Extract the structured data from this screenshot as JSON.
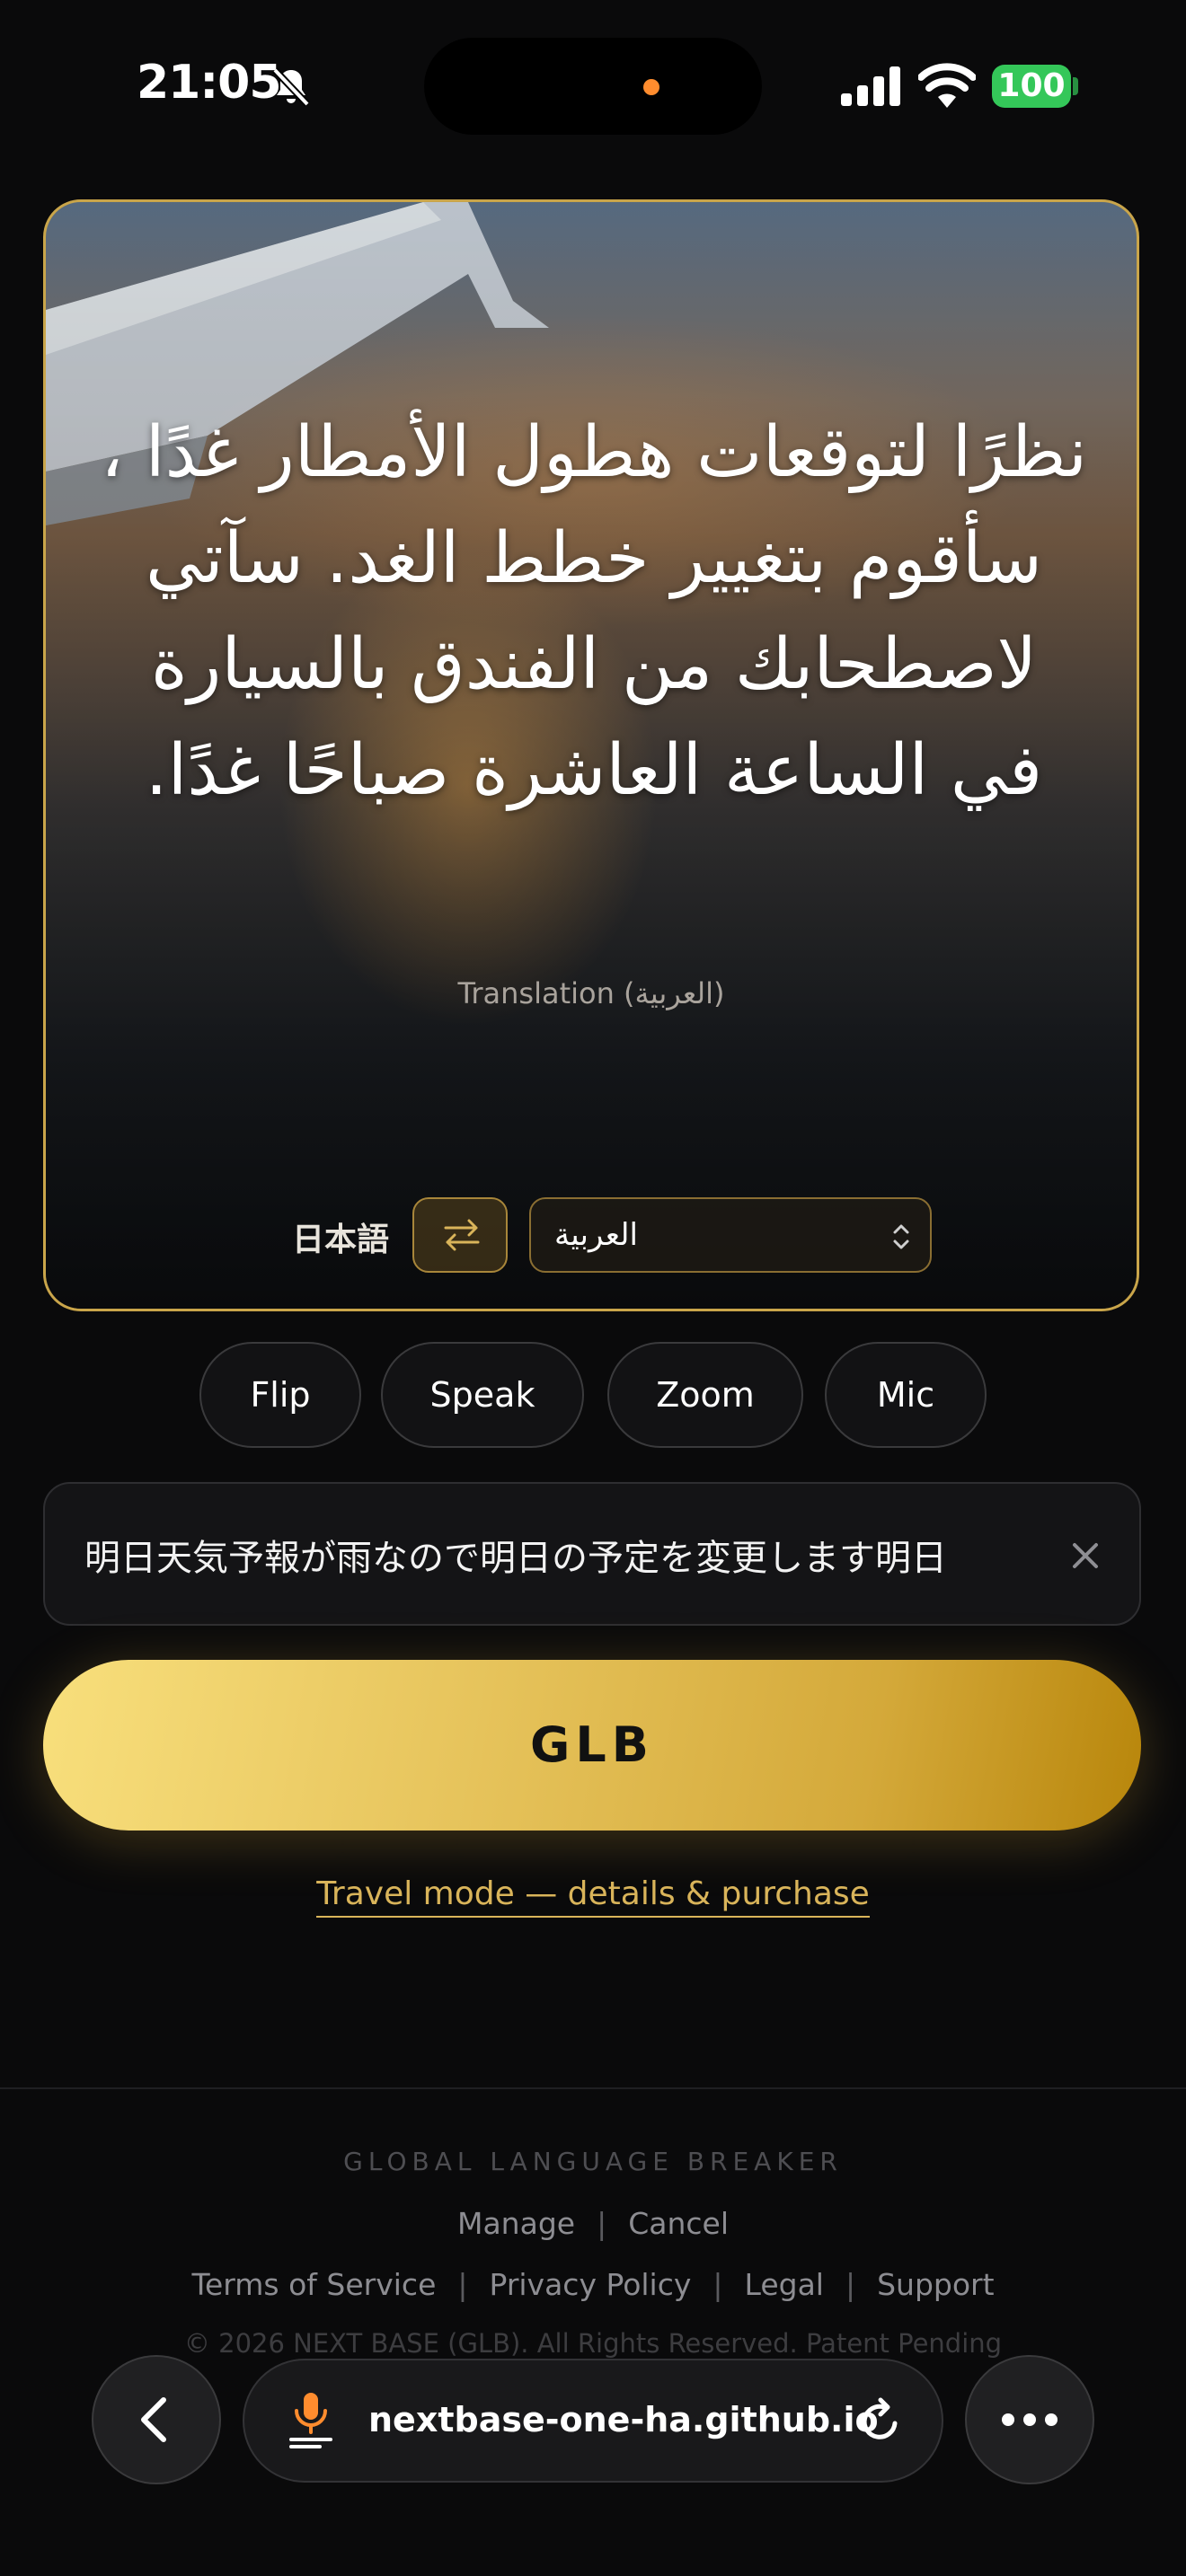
{
  "status_bar": {
    "time": "21:05",
    "battery": "100"
  },
  "card": {
    "translation": "نظرًا لتوقعات هطول الأمطار غدًا ، سأقوم بتغيير خطط الغد. سآتي لاصطحابك من الفندق بالسيارة في الساعة العاشرة صباحًا غدًا.",
    "translation_label": "Translation (العربية)",
    "source_language": "日本語",
    "target_language": "العربية"
  },
  "actions": [
    "Flip",
    "Speak",
    "Zoom",
    "Mic"
  ],
  "input": {
    "value": "明日天気予報が雨なので明日の予定を変更します明日"
  },
  "main_button": "GLB",
  "travel_link": "Travel mode — details & purchase",
  "footer": {
    "brand": "GLOBAL LANGUAGE BREAKER",
    "manage": "Manage",
    "cancel": "Cancel",
    "terms": "Terms of Service",
    "privacy": "Privacy Policy",
    "legal": "Legal",
    "support": "Support",
    "copyright": "© 2026 NEXT BASE (GLB). All Rights Reserved. Patent Pending"
  },
  "browser": {
    "url": "nextbase-one-ha.github.io"
  },
  "colors": {
    "accent": "#c9a54a",
    "button_gold": "#e6c35b",
    "battery": "#34c759"
  }
}
